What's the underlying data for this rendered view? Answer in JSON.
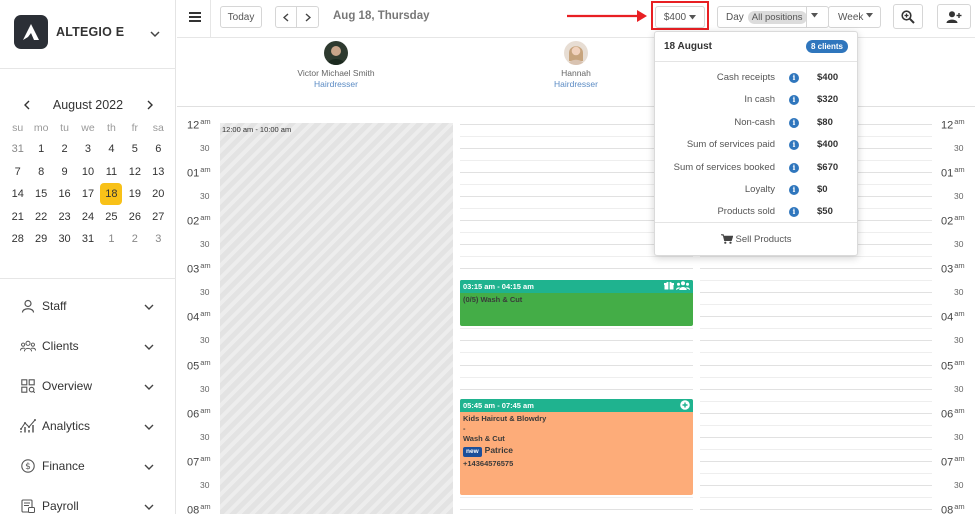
{
  "brand": {
    "name": "ALTEGIO E"
  },
  "calendar": {
    "month_label": "August 2022",
    "dow": [
      "su",
      "mo",
      "tu",
      "we",
      "th",
      "fr",
      "sa"
    ],
    "weeks": [
      [
        "31",
        "1",
        "2",
        "3",
        "4",
        "5",
        "6"
      ],
      [
        "7",
        "8",
        "9",
        "10",
        "11",
        "12",
        "13"
      ],
      [
        "14",
        "15",
        "16",
        "17",
        "18",
        "19",
        "20"
      ],
      [
        "21",
        "22",
        "23",
        "24",
        "25",
        "26",
        "27"
      ],
      [
        "28",
        "29",
        "30",
        "31",
        "1",
        "2",
        "3"
      ]
    ],
    "selected": "18"
  },
  "menu": [
    {
      "label": "Staff",
      "icon": "person-icon"
    },
    {
      "label": "Clients",
      "icon": "clients-icon"
    },
    {
      "label": "Overview",
      "icon": "overview-icon"
    },
    {
      "label": "Analytics",
      "icon": "analytics-icon"
    },
    {
      "label": "Finance",
      "icon": "finance-icon"
    },
    {
      "label": "Payroll",
      "icon": "payroll-icon"
    }
  ],
  "toolbar": {
    "today_label": "Today",
    "date_label": "Aug 18, Thursday",
    "total_label": "$400",
    "day_label": "Day",
    "positions_label": "All positions",
    "week_label": "Week"
  },
  "staff": [
    {
      "name": "Victor Michael Smith",
      "role": "Hairdresser"
    },
    {
      "name": "Hannah",
      "role": "Hairdresser"
    }
  ],
  "timeline": {
    "hours": [
      "12",
      "01",
      "02",
      "03",
      "04",
      "05",
      "06",
      "07",
      "08"
    ],
    "suffix": "am",
    "half": "30"
  },
  "unavailable": {
    "label": "12:00 am - 10:00 am"
  },
  "appointments": [
    {
      "time": "03:15 am - 04:15 am",
      "lines": [
        "(0/5) Wash & Cut"
      ],
      "color": "#44ad47"
    },
    {
      "time": "05:45 am - 07:45 am",
      "lines": [
        "Kids Haircut & Blowdry",
        "-",
        "Wash & Cut"
      ],
      "new_tag": "new",
      "client": "Patrice",
      "phone": "+14364576575",
      "color": "#fdac79"
    }
  ],
  "popover": {
    "date": "18 August",
    "badge": "8 clients",
    "rows": [
      {
        "label": "Cash receipts",
        "value": "$400"
      },
      {
        "label": "In cash",
        "value": "$320"
      },
      {
        "label": "Non-cash",
        "value": "$80"
      },
      {
        "label": "Sum of services paid",
        "value": "$400"
      },
      {
        "label": "Sum of services booked",
        "value": "$670"
      },
      {
        "label": "Loyalty",
        "value": "$0"
      },
      {
        "label": "Products sold",
        "value": "$50"
      }
    ],
    "footer": "Sell Products",
    "info_glyph": "i"
  },
  "colors": {
    "accent": "#f8c118",
    "highlight": "#e81f23",
    "appt_header": "#1fb38f",
    "link": "#2f76bd"
  }
}
